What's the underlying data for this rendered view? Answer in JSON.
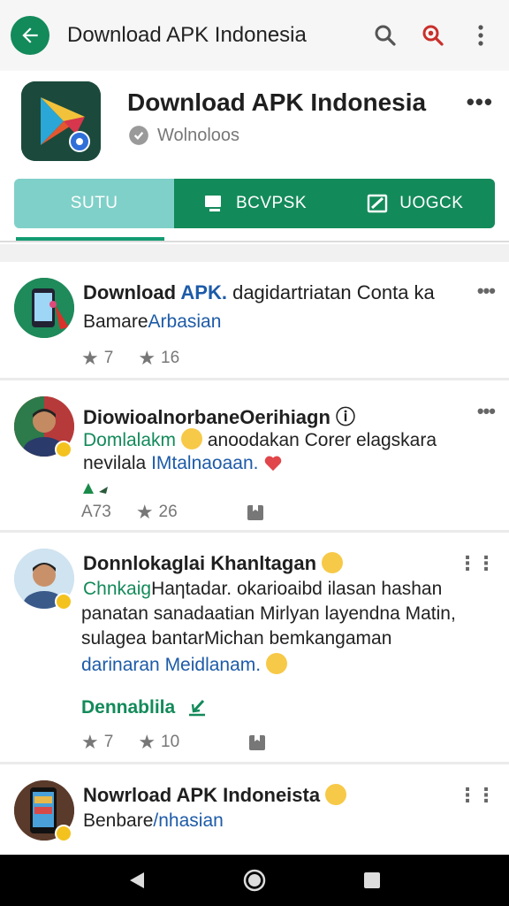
{
  "topbar": {
    "title": "Download APK Indonesia"
  },
  "app": {
    "title": "Download APK Indonesia",
    "subtitle": "Wolnoloos",
    "more": "•••"
  },
  "tabs": [
    {
      "label": "SUTU",
      "icon": "none"
    },
    {
      "label": "BCVPSK",
      "icon": "monitor-icon"
    },
    {
      "label": "UOGCK",
      "icon": "edit-icon"
    }
  ],
  "posts": [
    {
      "title_a": "Download ",
      "title_b": "APK.",
      "title_c": " dagidartriatan Conta ka",
      "line1_a": "Bamare",
      "line1_b": "Arbasian",
      "stat1": "7",
      "stat2": "16"
    },
    {
      "title": "DiowioalnorbaneOerihiagn ⓘ",
      "line1_a": "Domlalakm",
      "line1_b": " anoodakan Corer elagskara",
      "line2_a": "nevilala ",
      "line2_b": "IMtalnaoaan.",
      "stat1": "A73",
      "stat2": "26"
    },
    {
      "title": "Donnlokaglai Khanltagan",
      "line1_a": "Chnkaig",
      "line1_b": "Haηtadar. okarioaibd ilasan hashan",
      "line2": "panatan sanadaatian Mirlyan layendna Matin,",
      "line3": "sulagea bantarMichan bemkangaman",
      "line4_a": "darinaran ",
      "line4_b": "Meidlanam.",
      "action": "Dennablila",
      "stat1": "7",
      "stat2": "10"
    },
    {
      "title": "Nowrload APK Indoneista",
      "line1_a": "Benbare",
      "line1_b": "/nhasian"
    }
  ],
  "colors": {
    "accent": "#138a5a",
    "accent_light": "#7fd0c8",
    "link": "#1d5ba8"
  }
}
